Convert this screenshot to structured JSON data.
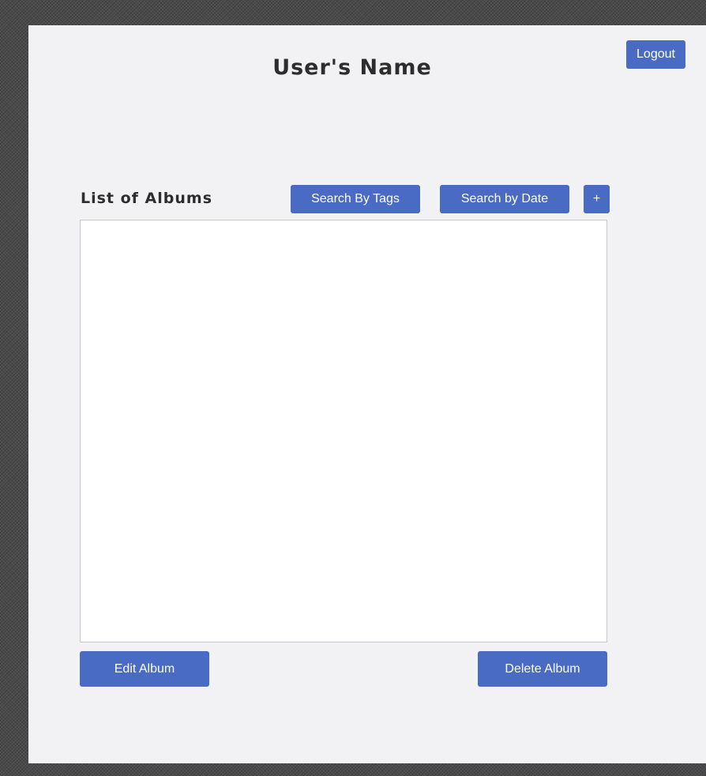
{
  "header": {
    "user_name": "User's Name",
    "logout_label": "Logout"
  },
  "albums": {
    "section_title": "List of Albums",
    "search_by_tags_label": "Search By Tags",
    "search_by_date_label": "Search by Date",
    "add_label": "+",
    "items": []
  },
  "actions": {
    "edit_label": "Edit Album",
    "delete_label": "Delete Album"
  },
  "colors": {
    "accent": "#4a6bc4",
    "window_bg": "#f2f2f4",
    "list_bg": "#ffffff"
  }
}
